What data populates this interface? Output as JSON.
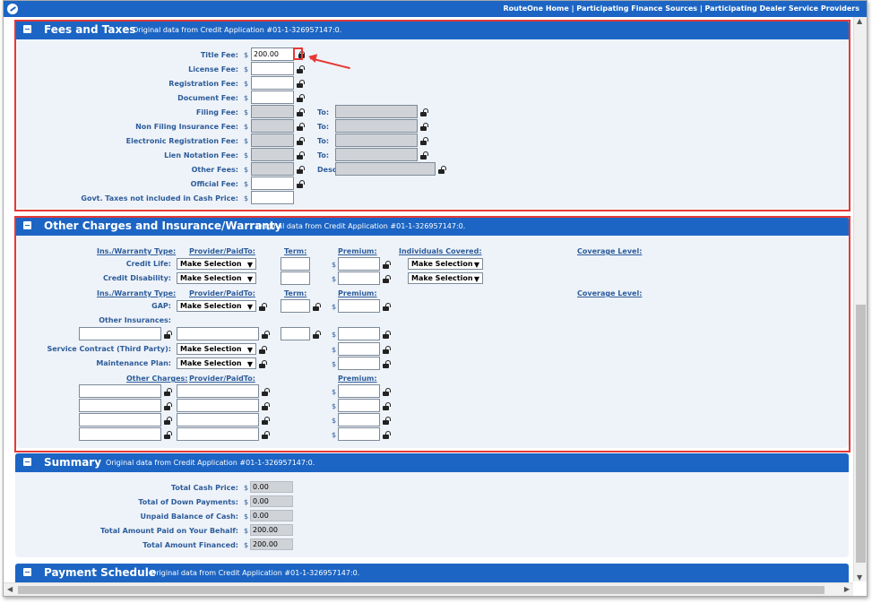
{
  "topnav": {
    "home": "RouteOne Home",
    "sep1": "|",
    "finance": "Participating Finance Sources",
    "sep2": "|",
    "dealer": "Participating Dealer Service Providers"
  },
  "fees": {
    "title": "Fees and Taxes",
    "subtitle": "Original data from Credit Application #01-1-326957147:0.",
    "rows": [
      {
        "label": "Title Fee:",
        "value": "200.00"
      },
      {
        "label": "License Fee:",
        "value": ""
      },
      {
        "label": "Registration Fee:",
        "value": ""
      },
      {
        "label": "Document Fee:",
        "value": ""
      },
      {
        "label": "Filing Fee:",
        "value": "",
        "to": "To:"
      },
      {
        "label": "Non Filing Insurance Fee:",
        "value": "",
        "to": "To:"
      },
      {
        "label": "Electronic Registration Fee:",
        "value": "",
        "to": "To:"
      },
      {
        "label": "Lien Notation Fee:",
        "value": "",
        "to": "To:"
      },
      {
        "label": "Other Fees:",
        "value": "",
        "to": "Desc"
      },
      {
        "label": "Official Fee:",
        "value": ""
      },
      {
        "label": "Govt. Taxes not included in Cash Price:",
        "value": ""
      }
    ],
    "currency": "$"
  },
  "insurance": {
    "title": "Other Charges and Insurance/Warranty",
    "subtitle": "Original data from Credit Application #01-1-326957147:0.",
    "headers": {
      "type": "Ins./Warranty Type:",
      "provider": "Provider/PaidTo:",
      "term": "Term:",
      "premium": "Premium:",
      "individuals": "Individuals Covered:",
      "coverage": "Coverage Level:",
      "other_charges": "Other Charges:"
    },
    "credit_life": "Credit Life:",
    "credit_disability": "Credit Disability:",
    "gap": "GAP:",
    "other_insurances": "Other Insurances:",
    "service_contract": "Service Contract (Third Party):",
    "maintenance_plan": "Maintenance Plan:",
    "select_default": "Make Selection",
    "currency": "$"
  },
  "summary": {
    "title": "Summary",
    "subtitle": "Original data from Credit Application #01-1-326957147:0.",
    "rows": [
      {
        "label": "Total Cash Price:",
        "value": "0.00"
      },
      {
        "label": "Total of Down Payments:",
        "value": "0.00"
      },
      {
        "label": "Unpaid Balance of Cash:",
        "value": "0.00"
      },
      {
        "label": "Total Amount Paid on Your Behalf:",
        "value": "200.00"
      },
      {
        "label": "Total Amount Financed:",
        "value": "200.00"
      }
    ],
    "currency": "$"
  },
  "payment": {
    "title": "Payment Schedule",
    "subtitle": "Original data from Credit Application #01-1-326957147:0."
  },
  "colors": {
    "header_blue": "#1c65c4",
    "highlight_red": "#e53935",
    "panel_bg": "#eef3f9"
  }
}
